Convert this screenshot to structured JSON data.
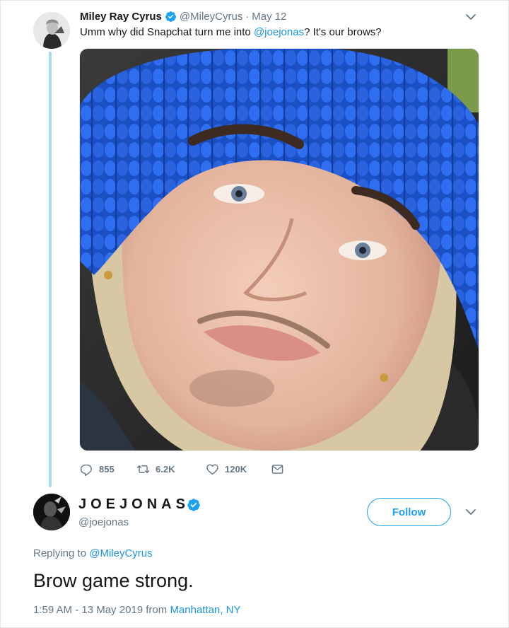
{
  "tweet": {
    "author_name": "Miley Ray Cyrus",
    "author_handle": "@MileyCyrus",
    "separator": "·",
    "date": "May 12",
    "text_before": "Umm why did Snapchat turn me into ",
    "text_mention": "@joejonas",
    "text_after": "? It's our brows?",
    "reply_count": "855",
    "retweet_count": "6.2K",
    "like_count": "120K"
  },
  "reply": {
    "author_name": "JOEJONAS",
    "author_handle": "@joejonas",
    "follow_label": "Follow",
    "replying_prefix": "Replying to ",
    "replying_to": "@MileyCyrus",
    "text": "Brow game strong.",
    "timestamp": "1:59 AM - 13 May 2019 from ",
    "location": "Manhattan, NY"
  },
  "colors": {
    "accent": "#1da1f2",
    "link": "#1b95e0",
    "muted": "#657786",
    "thread_line": "#a9d9f6",
    "text": "#14171a"
  },
  "icons": [
    "verified-badge-icon",
    "chevron-down-icon",
    "reply-icon",
    "retweet-icon",
    "heart-icon",
    "direct-message-icon"
  ]
}
